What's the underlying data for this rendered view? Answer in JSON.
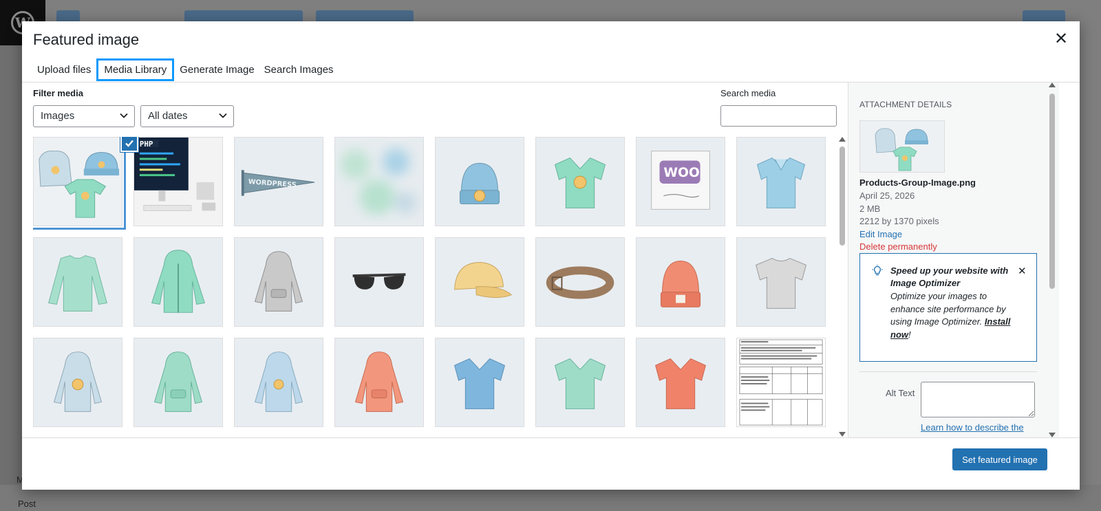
{
  "background": {
    "bottom_left_label": "Post",
    "bottom_left_initial": "M"
  },
  "modal": {
    "title": "Featured image",
    "tabs": [
      {
        "label": "Upload files",
        "active": false
      },
      {
        "label": "Media Library",
        "active": true
      },
      {
        "label": "Generate Image",
        "active": false
      },
      {
        "label": "Search Images",
        "active": false
      }
    ]
  },
  "toolbar": {
    "filter_label": "Filter media",
    "type_select": "Images",
    "date_select": "All dates",
    "search_label": "Search media",
    "search_value": ""
  },
  "media_grid": [
    {
      "icon": "products-group-image",
      "selected": true
    },
    {
      "icon": "php-desk-photo"
    },
    {
      "icon": "wordpress-pennant"
    },
    {
      "icon": "blurred-image"
    },
    {
      "icon": "beanie"
    },
    {
      "icon": "v-neck-tee-logo"
    },
    {
      "icon": "woo-album"
    },
    {
      "icon": "polo-shirt"
    },
    {
      "icon": "long-sleeve-tee"
    },
    {
      "icon": "zip-hoodie"
    },
    {
      "icon": "gray-hoodie"
    },
    {
      "icon": "sunglasses"
    },
    {
      "icon": "cap"
    },
    {
      "icon": "belt"
    },
    {
      "icon": "orange-beanie"
    },
    {
      "icon": "gray-tee"
    },
    {
      "icon": "hoodie-logo"
    },
    {
      "icon": "green-hoodie"
    },
    {
      "icon": "hoodie-blue-logo"
    },
    {
      "icon": "orange-hoodie"
    },
    {
      "icon": "blue-v-neck"
    },
    {
      "icon": "green-v-neck"
    },
    {
      "icon": "orange-v-neck"
    },
    {
      "icon": "document-page"
    }
  ],
  "attachment": {
    "heading": "ATTACHMENT DETAILS",
    "filename": "Products-Group-Image.png",
    "date": "April 25, 2026",
    "size": "2 MB",
    "dimensions": "2212 by 1370 pixels",
    "edit_link": "Edit Image",
    "delete_link": "Delete permanently",
    "promo_title": "Speed up your website with Image Optimizer",
    "promo_body": "Optimize your images to enhance site performance by using Image Optimizer.",
    "promo_link": "Install now",
    "promo_end": "!",
    "alt_label": "Alt Text",
    "alt_value": "",
    "alt_help": "Learn how to describe the"
  },
  "footer": {
    "primary_button": "Set featured image"
  }
}
